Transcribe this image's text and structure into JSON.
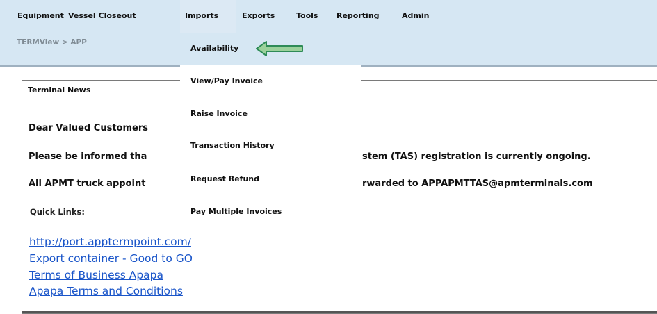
{
  "top_menu": {
    "items": [
      {
        "label": "Equipment"
      },
      {
        "label": "Vessel Closeout"
      },
      {
        "label": "Imports"
      },
      {
        "label": "Exports"
      },
      {
        "label": "Tools"
      },
      {
        "label": "Reporting"
      },
      {
        "label": "Admin"
      }
    ]
  },
  "breadcrumb": "TERMView > APP",
  "imports_dropdown": {
    "items": [
      {
        "label": "Availability"
      },
      {
        "label": "View/Pay Invoice"
      },
      {
        "label": "Raise Invoice"
      },
      {
        "label": "Transaction History"
      },
      {
        "label": "Request Refund"
      },
      {
        "label": "Pay Multiple Invoices"
      }
    ],
    "indicator": "arrow-left-icon"
  },
  "terminal_news": {
    "title": "Terminal News",
    "greeting": "Dear Valued Customers",
    "line1_left": "Please be informed tha",
    "line1_right": "stem (TAS) registration is currently ongoing.",
    "line2_left": "All APMT truck appoint",
    "line2_right": "rwarded to APPAPMTTAS@apmterminals.com",
    "quick_links_label": "Quick Links:",
    "links": [
      {
        "label": "http://port.apptermpoint.com/"
      },
      {
        "label": "Export container - Good to GO"
      },
      {
        "label": "Terms of Business Apapa"
      },
      {
        "label": "Apapa Terms and Conditions"
      }
    ]
  },
  "colors": {
    "menu_bg": "#d6e7f3",
    "link": "#1a55c9",
    "arrow_fill": "#9bd19b",
    "arrow_stroke": "#2e8b57"
  }
}
